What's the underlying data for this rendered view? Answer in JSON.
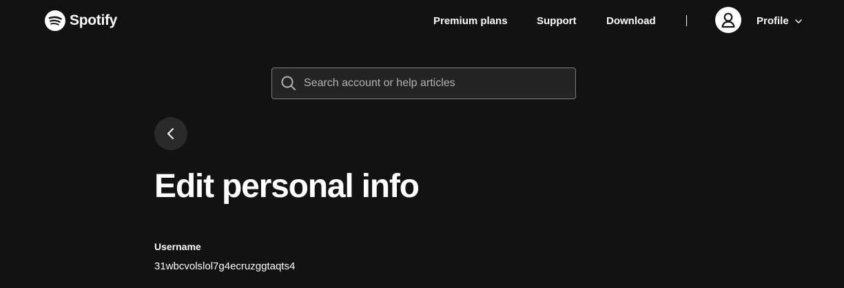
{
  "header": {
    "brand": "Spotify",
    "nav": {
      "premium": "Premium plans",
      "support": "Support",
      "download": "Download"
    },
    "profile_label": "Profile"
  },
  "search": {
    "placeholder": "Search account or help articles",
    "value": ""
  },
  "page": {
    "title": "Edit personal info"
  },
  "fields": {
    "username": {
      "label": "Username",
      "value": "31wbcvolslol7g4ecruzggtaqts4"
    }
  },
  "colors": {
    "background": "#121212",
    "search_background": "#242424",
    "back_button_background": "#2a2a2a",
    "text": "#ffffff"
  },
  "icons": {
    "logo": "spotify-logo-icon",
    "avatar": "user-icon",
    "dropdown": "chevron-down-icon",
    "search": "search-icon",
    "back": "chevron-left-icon"
  }
}
